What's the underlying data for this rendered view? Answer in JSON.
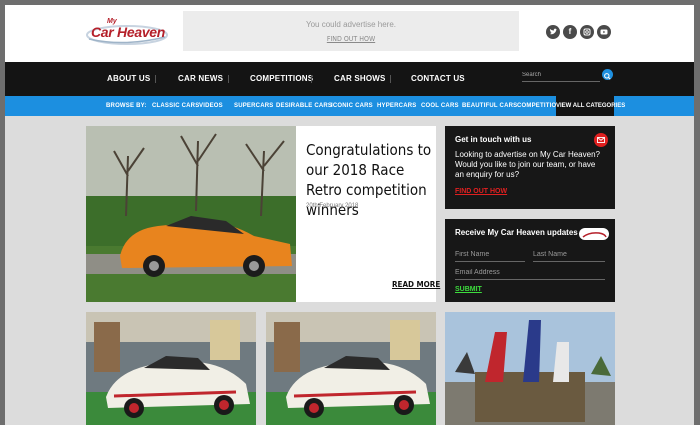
{
  "brand": {
    "small": "My",
    "name": "Car Heaven"
  },
  "ad": {
    "text": "You could advertise here.",
    "link": "FIND OUT HOW"
  },
  "social": [
    "twitter-icon",
    "facebook-icon",
    "instagram-icon",
    "youtube-icon"
  ],
  "nav": {
    "items": [
      "ABOUT US",
      "CAR NEWS",
      "COMPETITIONS",
      "CAR SHOWS",
      "CONTACT US"
    ]
  },
  "search": {
    "placeholder": "Search"
  },
  "browse": {
    "label": "BROWSE BY:",
    "items": [
      "CLASSIC CARS",
      "VIDEOS",
      "SUPERCARS",
      "DESIRABLE CARS",
      "ICONIC CARS",
      "HYPERCARS",
      "COOL CARS",
      "BEAUTIFUL CARS",
      "COMPETITIONS"
    ],
    "all": "VIEW ALL CATEGORIES"
  },
  "feature": {
    "title": "Congratulations to our 2018 Race Retro competition winners",
    "date": "20th February 2018",
    "more": "READ MORE"
  },
  "contact": {
    "title": "Get in touch with us",
    "text": "Looking to advertise on My Car Heaven? Would you like to join our team, or have an enquiry for us?",
    "link": "FIND OUT HOW"
  },
  "newsletter": {
    "title": "Receive My Car Heaven updates",
    "first_name": "First Name",
    "last_name": "Last Name",
    "email": "Email Address",
    "submit": "SUBMIT"
  },
  "colors": {
    "nav_bg": "#141414",
    "browse_bg": "#1c8fe0",
    "accent_red": "#e02020",
    "submit_green": "#3ddc3d",
    "brand_red": "#b5202a"
  }
}
